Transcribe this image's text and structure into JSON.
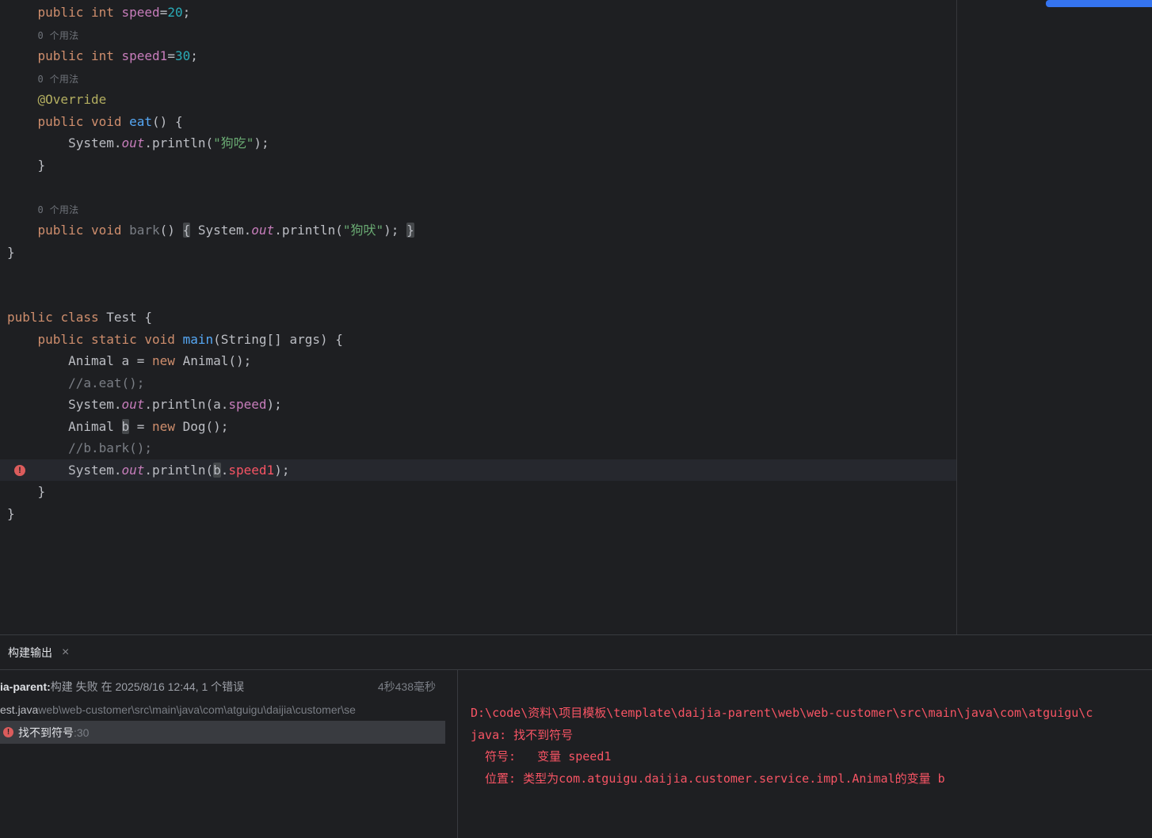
{
  "colors": {
    "error_red": "#f75464",
    "accent_blue": "#3574f0",
    "selection_gray": "#393b40",
    "editor_bg": "#1e1f22"
  },
  "editor": {
    "lines": [
      {
        "t": [
          [
            "d",
            "    "
          ],
          [
            "kw",
            "public"
          ],
          [
            "d",
            " "
          ],
          [
            "kw",
            "int"
          ],
          [
            "d",
            " "
          ],
          [
            "fld",
            "speed"
          ],
          [
            "d",
            "="
          ],
          [
            "num",
            "20"
          ],
          [
            "d",
            ";"
          ]
        ]
      },
      {
        "inlay": "0 个用法",
        "pre": "    "
      },
      {
        "t": [
          [
            "d",
            "    "
          ],
          [
            "kw",
            "public"
          ],
          [
            "d",
            " "
          ],
          [
            "kw",
            "int"
          ],
          [
            "d",
            " "
          ],
          [
            "fld",
            "speed1"
          ],
          [
            "d",
            "="
          ],
          [
            "num",
            "30"
          ],
          [
            "d",
            ";"
          ]
        ]
      },
      {
        "inlay": "0 个用法",
        "pre": "    "
      },
      {
        "t": [
          [
            "d",
            "    "
          ],
          [
            "ann",
            "@Override"
          ]
        ]
      },
      {
        "t": [
          [
            "d",
            "    "
          ],
          [
            "kw",
            "public"
          ],
          [
            "d",
            " "
          ],
          [
            "kw",
            "void"
          ],
          [
            "d",
            " "
          ],
          [
            "mth",
            "eat"
          ],
          [
            "d",
            "() {"
          ]
        ]
      },
      {
        "t": [
          [
            "d",
            "        System."
          ],
          [
            "out",
            "out"
          ],
          [
            "d",
            ".println("
          ],
          [
            "str",
            "\"狗吃\""
          ],
          [
            "d",
            ");"
          ]
        ]
      },
      {
        "t": [
          [
            "d",
            "    }"
          ]
        ]
      },
      {
        "t": []
      },
      {
        "inlay": "0 个用法",
        "pre": "    "
      },
      {
        "t": [
          [
            "d",
            "    "
          ],
          [
            "kw",
            "public"
          ],
          [
            "d",
            " "
          ],
          [
            "kw",
            "void"
          ],
          [
            "d",
            " "
          ],
          [
            "dim",
            "bark"
          ],
          [
            "d",
            "() "
          ],
          [
            "d hl",
            "{"
          ],
          [
            "d",
            " System."
          ],
          [
            "out",
            "out"
          ],
          [
            "d",
            ".println("
          ],
          [
            "str",
            "\"狗吠\""
          ],
          [
            "d",
            "); "
          ],
          [
            "d hl",
            "}"
          ]
        ]
      },
      {
        "t": [
          [
            "d",
            "}"
          ]
        ]
      },
      {
        "t": []
      },
      {
        "t": []
      },
      {
        "t": [
          [
            "kw",
            "public"
          ],
          [
            "d",
            " "
          ],
          [
            "kw",
            "class"
          ],
          [
            "d",
            " Test {"
          ]
        ]
      },
      {
        "t": [
          [
            "d",
            "    "
          ],
          [
            "kw",
            "public"
          ],
          [
            "d",
            " "
          ],
          [
            "kw",
            "static"
          ],
          [
            "d",
            " "
          ],
          [
            "kw",
            "void"
          ],
          [
            "d",
            " "
          ],
          [
            "mth",
            "main"
          ],
          [
            "d",
            "(String[] args) {"
          ]
        ]
      },
      {
        "t": [
          [
            "d",
            "        Animal a = "
          ],
          [
            "kw",
            "new"
          ],
          [
            "d",
            " Animal();"
          ]
        ]
      },
      {
        "t": [
          [
            "d",
            "        "
          ],
          [
            "cmt",
            "//a.eat();"
          ]
        ]
      },
      {
        "t": [
          [
            "d",
            "        System."
          ],
          [
            "out",
            "out"
          ],
          [
            "d",
            ".println(a."
          ],
          [
            "fld",
            "speed"
          ],
          [
            "d",
            ");"
          ]
        ]
      },
      {
        "t": [
          [
            "d",
            "        Animal "
          ],
          [
            "d hl",
            "b"
          ],
          [
            "d",
            " = "
          ],
          [
            "kw",
            "new"
          ],
          [
            "d",
            " Dog();"
          ]
        ]
      },
      {
        "t": [
          [
            "d",
            "        "
          ],
          [
            "cmt",
            "//b.bark();"
          ]
        ]
      },
      {
        "t": [
          [
            "d",
            "        System."
          ],
          [
            "out",
            "out"
          ],
          [
            "d",
            ".println("
          ],
          [
            "d hl",
            "b"
          ],
          [
            "d",
            "."
          ],
          [
            "err",
            "speed1"
          ],
          [
            "d",
            ");"
          ]
        ],
        "cur": true,
        "gut": true
      },
      {
        "t": [
          [
            "d",
            "    }"
          ]
        ]
      },
      {
        "t": [
          [
            "d",
            "}"
          ]
        ]
      }
    ],
    "gutter_error_glyph": "!"
  },
  "panel": {
    "tab_label": "构建输出",
    "close_glyph": "×"
  },
  "tree": {
    "root": {
      "prefix": "ia-parent:",
      "text": " 构建 失败 在 2025/8/16 12:44, 1 个错误",
      "duration": "4秒438毫秒"
    },
    "file_row": {
      "name": "est.java",
      "path": " web\\web-customer\\src\\main\\java\\com\\atguigu\\daijia\\customer\\se"
    },
    "error_row": {
      "badge_glyph": "!",
      "label": "找不到符号",
      "line_ref": " :30"
    }
  },
  "console": {
    "lines": [
      "D:\\code\\资料\\项目模板\\template\\daijia-parent\\web\\web-customer\\src\\main\\java\\com\\atguigu\\c",
      "java: 找不到符号",
      "  符号:   变量 speed1",
      "  位置: 类型为com.atguigu.daijia.customer.service.impl.Animal的变量 b"
    ]
  }
}
